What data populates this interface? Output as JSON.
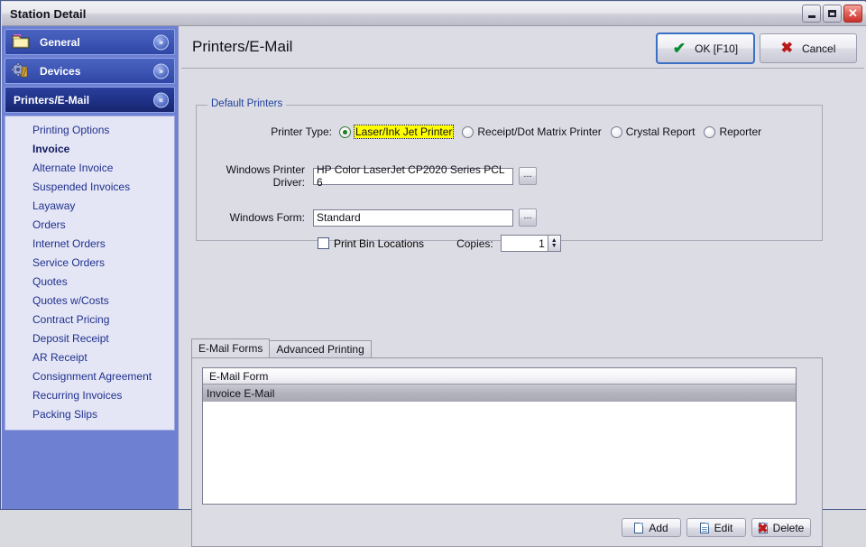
{
  "window": {
    "title": "Station Detail",
    "controls": [
      {
        "name": "minimize",
        "glyph": "_"
      },
      {
        "name": "maximize",
        "glyph": "□"
      },
      {
        "name": "close",
        "glyph": "✕"
      }
    ]
  },
  "sidebar": {
    "groups": [
      {
        "label": "General",
        "icon": "folder-icon",
        "expanded": false,
        "chevron": "»"
      },
      {
        "label": "Devices",
        "icon": "gear-icon",
        "expanded": false,
        "chevron": "»"
      },
      {
        "label": "Printers/E-Mail",
        "icon": "",
        "expanded": true,
        "chevron": "«"
      }
    ],
    "items": [
      {
        "label": "Printing Options",
        "selected": false
      },
      {
        "label": "Invoice",
        "selected": true
      },
      {
        "label": "Alternate Invoice",
        "selected": false
      },
      {
        "label": "Suspended Invoices",
        "selected": false
      },
      {
        "label": "Layaway",
        "selected": false
      },
      {
        "label": "Orders",
        "selected": false
      },
      {
        "label": "Internet Orders",
        "selected": false
      },
      {
        "label": "Service Orders",
        "selected": false
      },
      {
        "label": "Quotes",
        "selected": false
      },
      {
        "label": "Quotes w/Costs",
        "selected": false
      },
      {
        "label": "Contract Pricing",
        "selected": false
      },
      {
        "label": "Deposit Receipt",
        "selected": false
      },
      {
        "label": "AR Receipt",
        "selected": false
      },
      {
        "label": "Consignment Agreement",
        "selected": false
      },
      {
        "label": "Recurring Invoices",
        "selected": false
      },
      {
        "label": "Packing Slips",
        "selected": false
      }
    ]
  },
  "header": {
    "page_title": "Printers/E-Mail",
    "ok_label": "OK [F10]",
    "cancel_label": "Cancel",
    "ok_icon": "✔",
    "cancel_icon": "✖"
  },
  "default_printers": {
    "legend": "Default Printers",
    "printer_type_label": "Printer Type:",
    "printer_type_options": [
      {
        "label": "Laser/Ink Jet Printer",
        "checked": true,
        "highlighted": true
      },
      {
        "label": "Receipt/Dot Matrix Printer",
        "checked": false,
        "highlighted": false
      },
      {
        "label": "Crystal Report",
        "checked": false,
        "highlighted": false
      },
      {
        "label": "Reporter",
        "checked": false,
        "highlighted": false
      }
    ],
    "driver_label": "Windows Printer Driver:",
    "driver_value": "HP Color LaserJet CP2020 Series PCL 6",
    "driver_browse": "...",
    "form_label": "Windows Form:",
    "form_value": "Standard",
    "form_browse": "...",
    "print_bin_label": "Print Bin Locations",
    "print_bin_checked": false,
    "copies_label": "Copies:",
    "copies_value": "1"
  },
  "tabs": [
    {
      "label": "E-Mail Forms",
      "active": true
    },
    {
      "label": "Advanced Printing",
      "active": false
    }
  ],
  "email_forms": {
    "column_header": "E-Mail Form",
    "rows": [
      {
        "label": "Invoice E-Mail",
        "selected": true
      }
    ],
    "buttons": [
      {
        "label": "Add",
        "icon": "new-document-icon"
      },
      {
        "label": "Edit",
        "icon": "edit-document-icon"
      },
      {
        "label": "Delete",
        "icon": "delete-document-icon"
      }
    ]
  },
  "colors": {
    "sidebar_bg": "#6e80d2",
    "nav_header": "#3d55b4",
    "nav_header_active": "#203289",
    "nav_list_bg": "#e4e6f6",
    "nav_text": "#20308c",
    "pane_bg": "#dcdce4",
    "legend_text": "#20419c",
    "highlight_yellow": "#ffff00",
    "ok_check": "#0a8a30",
    "cancel_x": "#b81a1a"
  }
}
